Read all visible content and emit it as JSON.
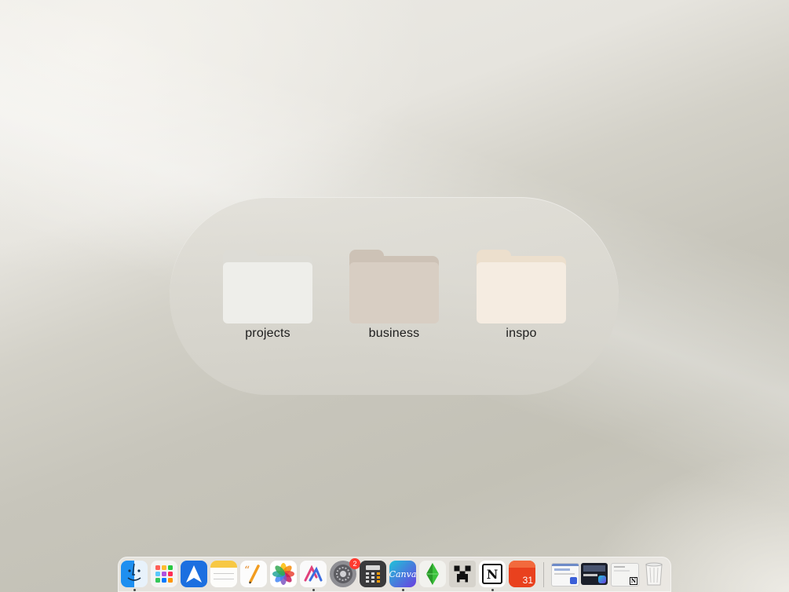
{
  "folders": [
    {
      "label": "projects",
      "icon": "folder-icon"
    },
    {
      "label": "business",
      "icon": "folder-icon"
    },
    {
      "label": "inspo",
      "icon": "folder-icon"
    }
  ],
  "dock": {
    "apps": [
      {
        "name": "Finder",
        "icon": "finder-icon",
        "running": true
      },
      {
        "name": "Launchpad",
        "icon": "launchpad-icon"
      },
      {
        "name": "Spark",
        "icon": "spark-mail-icon"
      },
      {
        "name": "Notes",
        "icon": "notes-icon"
      },
      {
        "name": "Pages",
        "icon": "pages-icon"
      },
      {
        "name": "Photos",
        "icon": "photos-icon"
      },
      {
        "name": "Affinity",
        "icon": "affinity-icon",
        "running": true
      },
      {
        "name": "System Settings",
        "icon": "settings-icon",
        "badge": "2"
      },
      {
        "name": "Calculator",
        "icon": "calculator-icon"
      },
      {
        "name": "Canva",
        "icon": "canva-icon",
        "label": "Canva",
        "running": true
      },
      {
        "name": "The Sims",
        "icon": "plumbob-icon"
      },
      {
        "name": "Minecraft",
        "icon": "minecraft-icon"
      },
      {
        "name": "Notion",
        "icon": "notion-icon",
        "label": "N",
        "running": true
      },
      {
        "name": "Fantastical",
        "icon": "calendar-icon",
        "label": "31"
      }
    ],
    "recents": [
      {
        "name": "recent-window-1"
      },
      {
        "name": "recent-window-2"
      },
      {
        "name": "recent-window-3",
        "label": "N"
      }
    ],
    "trash": {
      "name": "Trash",
      "icon": "trash-icon"
    }
  }
}
